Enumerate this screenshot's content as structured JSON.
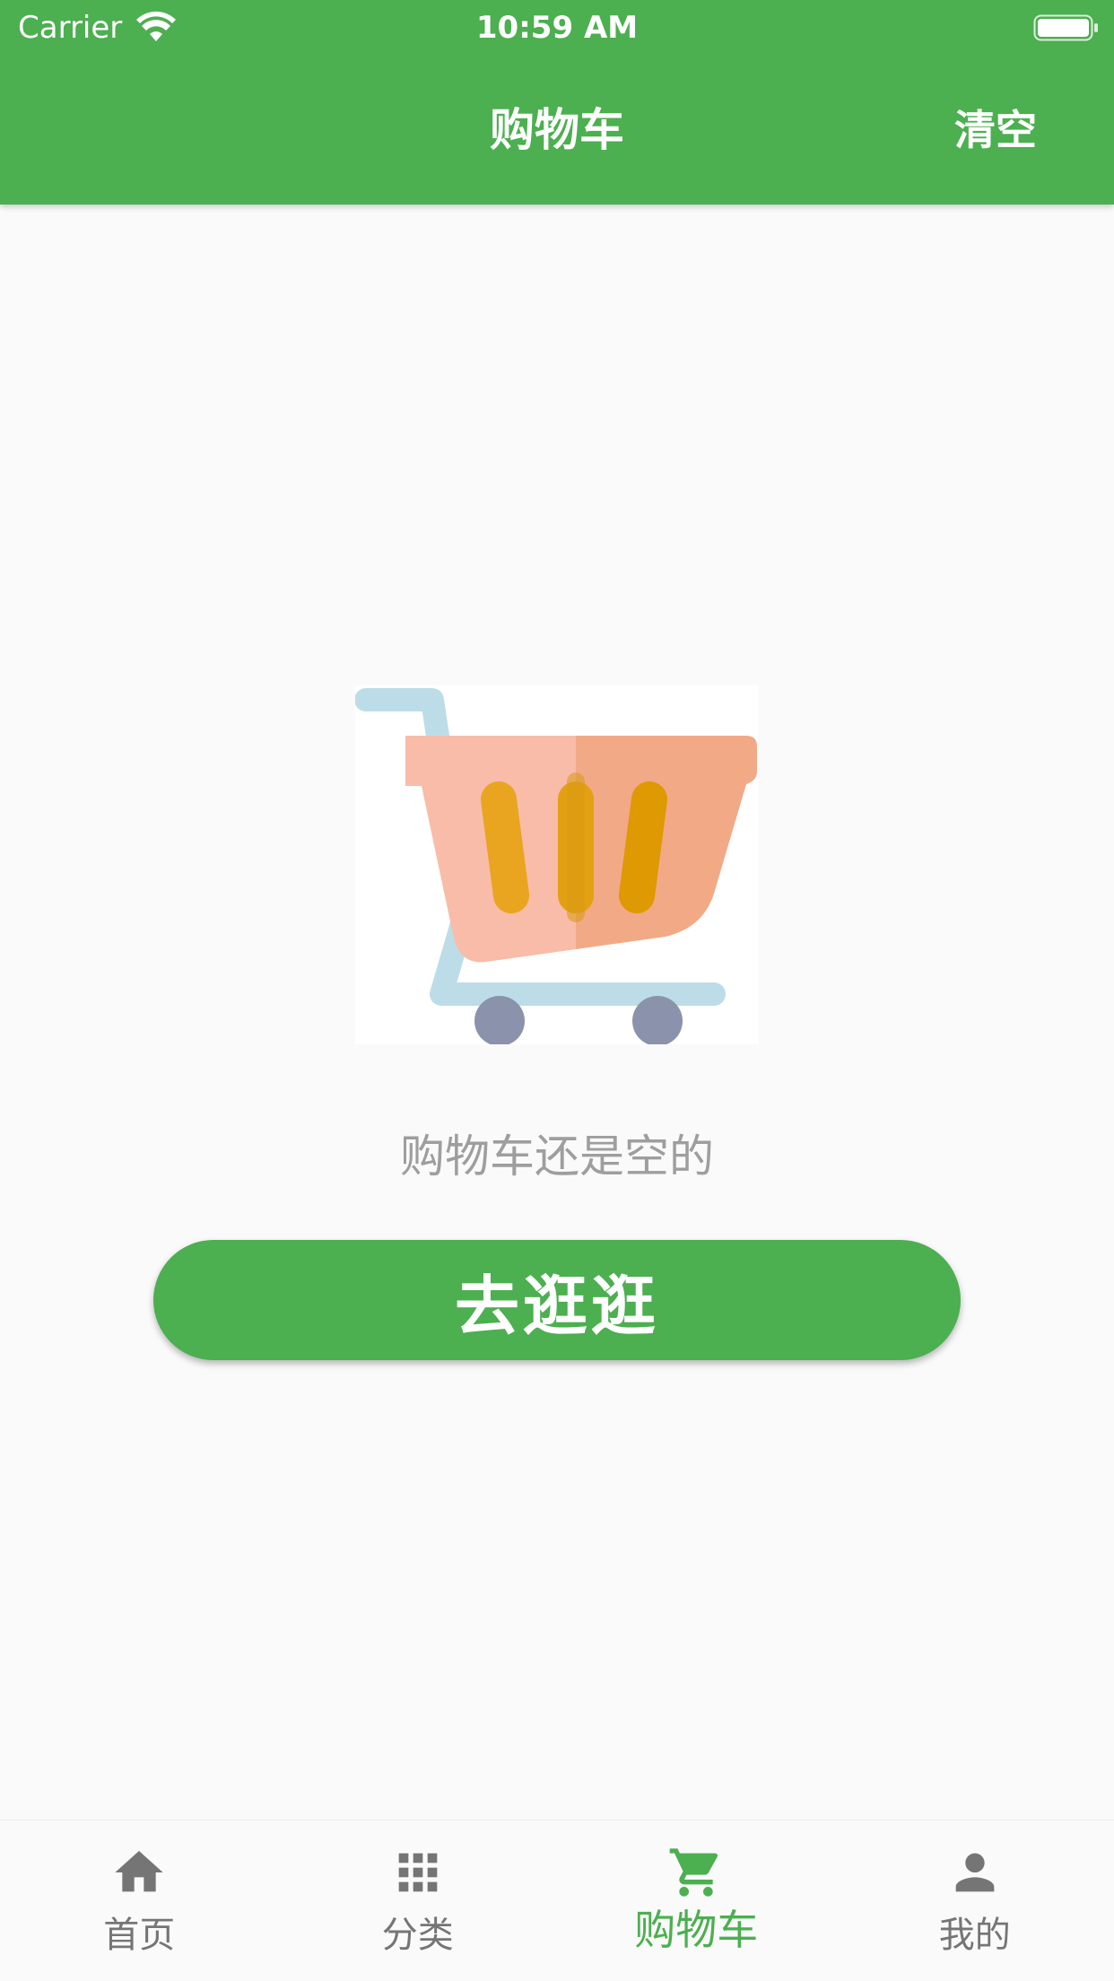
{
  "status_bar": {
    "carrier": "Carrier",
    "time": "10:59 AM"
  },
  "app_bar": {
    "title": "购物车",
    "action_label": "清空"
  },
  "empty_state": {
    "message": "购物车还是空的",
    "button_label": "去逛逛"
  },
  "bottom_nav": {
    "items": [
      {
        "label": "首页",
        "icon": "home-icon",
        "active": false
      },
      {
        "label": "分类",
        "icon": "grid-icon",
        "active": false
      },
      {
        "label": "购物车",
        "icon": "cart-icon",
        "active": true
      },
      {
        "label": "我的",
        "icon": "person-icon",
        "active": false
      }
    ]
  },
  "colors": {
    "primary": "#4caf50",
    "inactive": "#757575",
    "hint_text": "#9e9e9e",
    "background": "#fafafa"
  }
}
